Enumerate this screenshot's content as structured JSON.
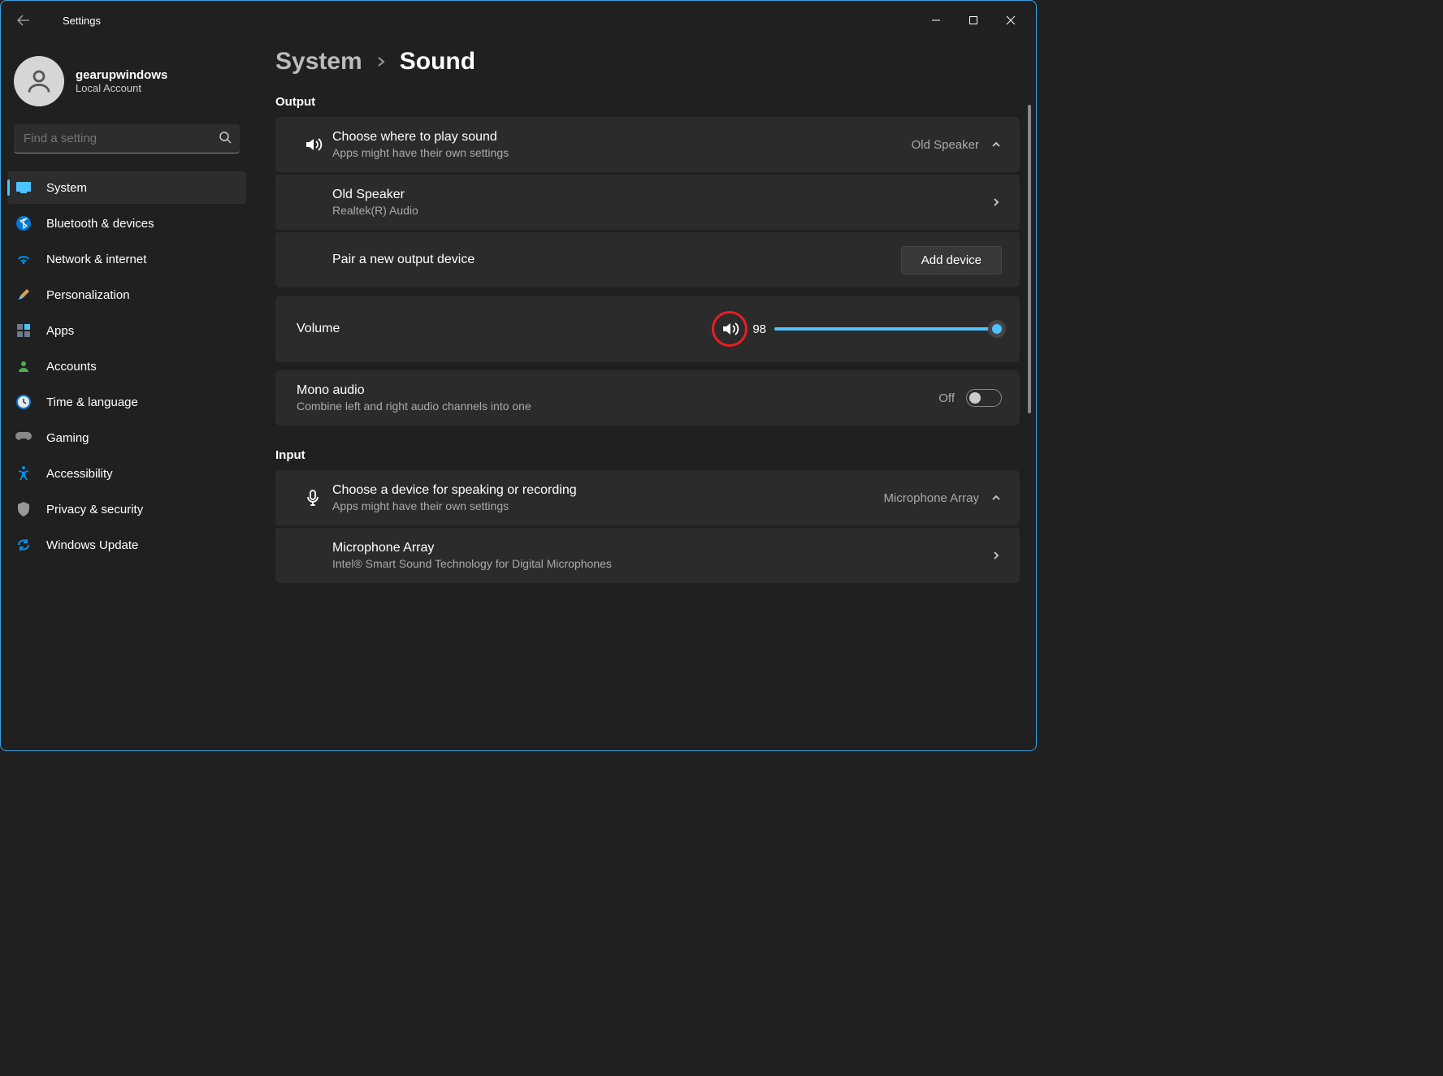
{
  "titlebar": {
    "title": "Settings"
  },
  "profile": {
    "name": "gearupwindows",
    "sub": "Local Account"
  },
  "search": {
    "placeholder": "Find a setting"
  },
  "nav": [
    {
      "label": "System",
      "icon": "system",
      "active": true
    },
    {
      "label": "Bluetooth & devices",
      "icon": "bluetooth"
    },
    {
      "label": "Network & internet",
      "icon": "wifi"
    },
    {
      "label": "Personalization",
      "icon": "brush"
    },
    {
      "label": "Apps",
      "icon": "apps"
    },
    {
      "label": "Accounts",
      "icon": "account"
    },
    {
      "label": "Time & language",
      "icon": "time"
    },
    {
      "label": "Gaming",
      "icon": "gaming"
    },
    {
      "label": "Accessibility",
      "icon": "accessibility"
    },
    {
      "label": "Privacy & security",
      "icon": "privacy"
    },
    {
      "label": "Windows Update",
      "icon": "update"
    }
  ],
  "breadcrumb": {
    "parent": "System",
    "current": "Sound"
  },
  "sections": {
    "output": {
      "label": "Output",
      "choose": {
        "title": "Choose where to play sound",
        "sub": "Apps might have their own settings",
        "value": "Old Speaker"
      },
      "device": {
        "title": "Old Speaker",
        "sub": "Realtek(R) Audio"
      },
      "pair": {
        "title": "Pair a new output device",
        "button": "Add device"
      },
      "volume": {
        "label": "Volume",
        "value": "98",
        "percent": 98
      },
      "mono": {
        "title": "Mono audio",
        "sub": "Combine left and right audio channels into one",
        "state": "Off"
      }
    },
    "input": {
      "label": "Input",
      "choose": {
        "title": "Choose a device for speaking or recording",
        "sub": "Apps might have their own settings",
        "value": "Microphone Array"
      },
      "device": {
        "title": "Microphone Array",
        "sub": "Intel® Smart Sound Technology for Digital Microphones"
      }
    }
  }
}
